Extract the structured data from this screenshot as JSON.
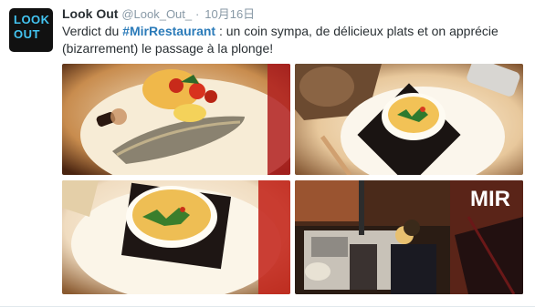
{
  "tweet": {
    "avatar": {
      "line1": "LOOK",
      "line2": "OUT"
    },
    "fullname": "Look Out",
    "username": "@Look_Out_",
    "separator": "·",
    "timestamp": "10月16日",
    "text_before": "Verdict du ",
    "hashtag": "#MirRestaurant",
    "text_after": " : un coin sympa, de délicieux plats et on apprécie (bizarrement) le passage à la plonge!"
  },
  "photos": [
    {
      "label": "grilled-fish-plate"
    },
    {
      "label": "creme-brulee-top-view"
    },
    {
      "label": "creme-brulee-close-up"
    },
    {
      "label": "restaurant-kitchen-view",
      "sign_text": "MIR"
    }
  ],
  "colors": {
    "hashtag": "#2b7bb9",
    "logo": "#43c4f1",
    "muted": "#8899a6"
  }
}
